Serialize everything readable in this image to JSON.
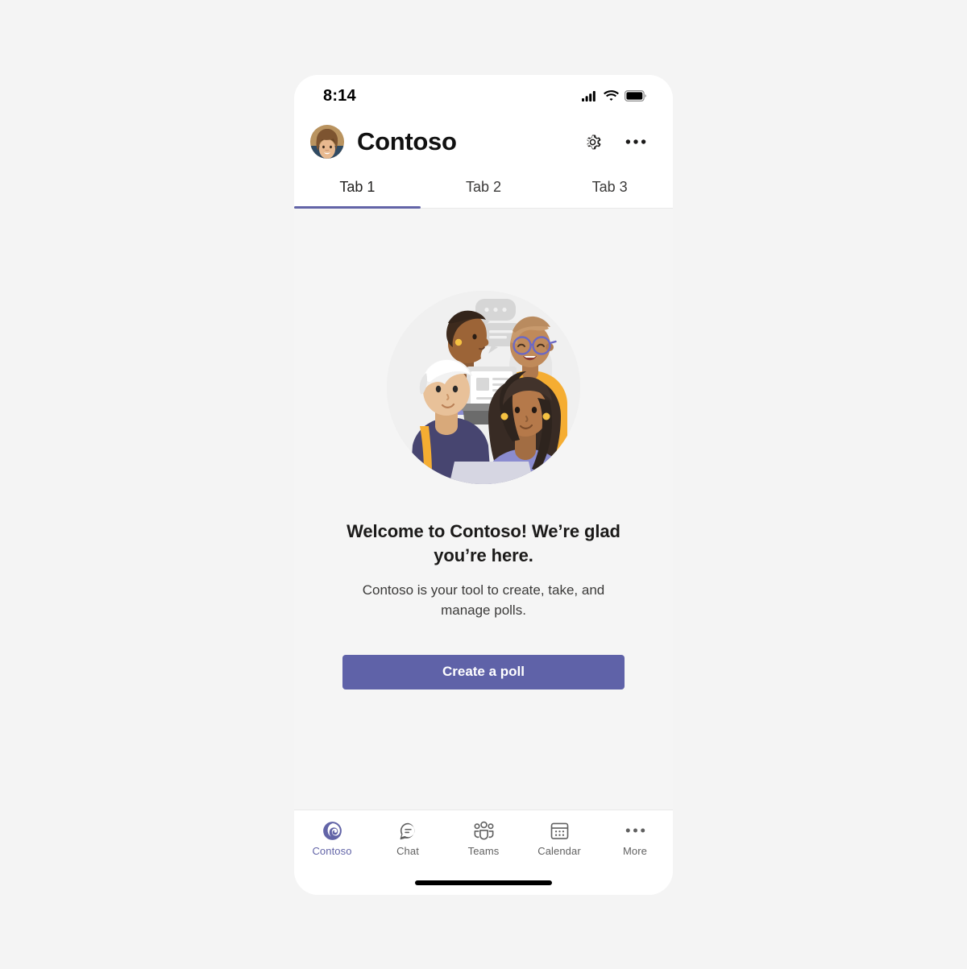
{
  "theme": {
    "page_bg": "#f4f4f4",
    "phone_bg": "#ffffff",
    "content_bg": "#f5f5f5",
    "accent": "#6264a7",
    "button_bg": "#5f62a8",
    "text_primary": "#1b1a19",
    "text_secondary": "#3b3a39",
    "nav_inactive": "#616161"
  },
  "status_bar": {
    "time": "8:14",
    "icons": [
      "cellular-signal-icon",
      "wifi-icon",
      "battery-icon"
    ]
  },
  "header": {
    "avatar_name": "user-avatar",
    "title": "Contoso",
    "settings_icon": "gear-icon",
    "more_icon": "more-horizontal-icon"
  },
  "tabs": {
    "active_index": 0,
    "items": [
      {
        "label": "Tab 1"
      },
      {
        "label": "Tab 2"
      },
      {
        "label": "Tab 3"
      }
    ]
  },
  "content": {
    "illustration_name": "team-collaboration-illustration",
    "title": "Welcome to Contoso! We’re glad you’re here.",
    "subtitle": "Contoso is your tool to create, take, and manage polls.",
    "cta_label": "Create a poll"
  },
  "bottom_nav": {
    "active_index": 0,
    "items": [
      {
        "label": "Contoso",
        "icon": "contoso-spiral-icon"
      },
      {
        "label": "Chat",
        "icon": "chat-bubble-icon"
      },
      {
        "label": "Teams",
        "icon": "people-group-icon"
      },
      {
        "label": "Calendar",
        "icon": "calendar-icon"
      },
      {
        "label": "More",
        "icon": "more-horizontal-icon"
      }
    ]
  },
  "home_indicator": "home-indicator-bar"
}
